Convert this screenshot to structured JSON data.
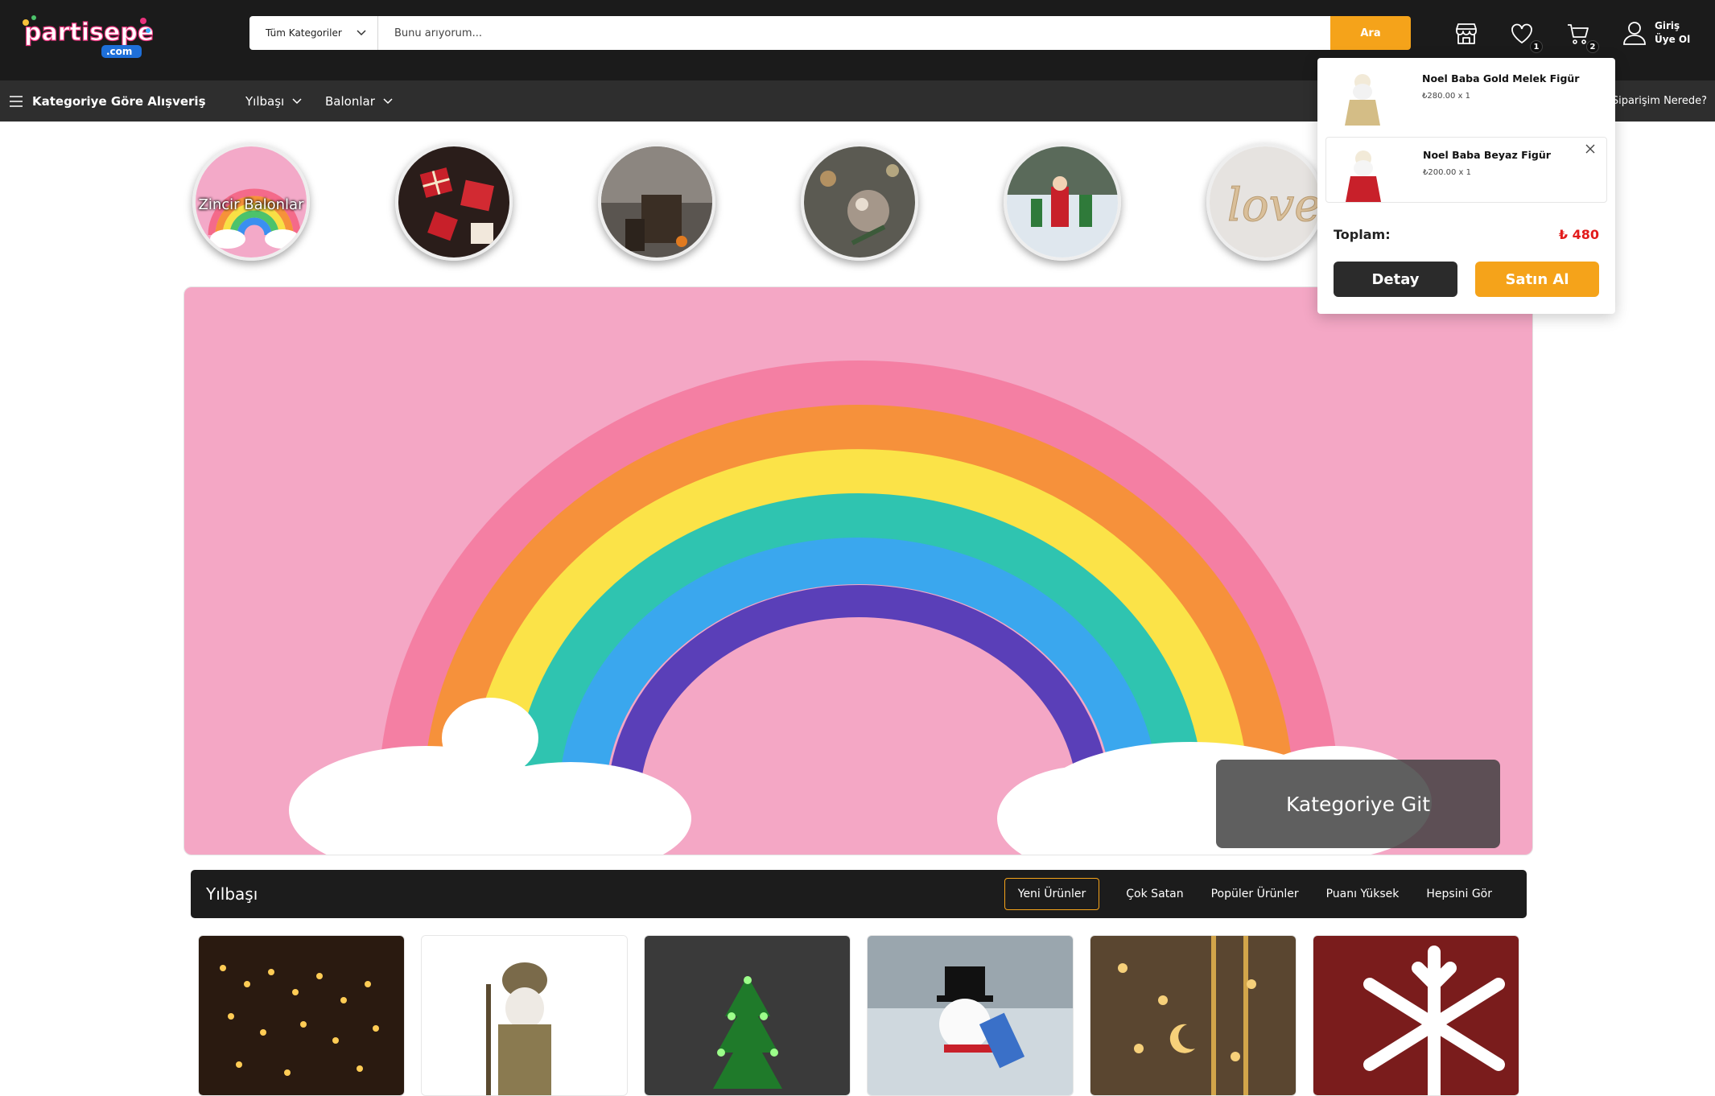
{
  "brand": {
    "name": "partisepeti",
    "domain": ".com",
    "colors": {
      "accent": "#f5a31a",
      "header_bg": "#1b1b1b",
      "nav_bg": "#2e2e2e",
      "price_red": "#e21b1b"
    }
  },
  "search": {
    "category_label": "Tüm Kategoriler",
    "placeholder": "Bunu arıyorum...",
    "button_label": "Ara"
  },
  "header_icons": {
    "store": "store-icon",
    "wishlist_count": "1",
    "cart_count": "2"
  },
  "account": {
    "line1": "Giriş",
    "line2": "Üye Ol"
  },
  "nav": {
    "shop_by_category": "Kategoriye Göre Alışveriş",
    "items": [
      {
        "label": "Yılbaşı"
      },
      {
        "label": "Balonlar"
      }
    ],
    "order_tracking": "Siparişim Nerede?"
  },
  "category_circles": [
    {
      "label": "Zincir Balonlar"
    }
  ],
  "banner": {
    "cta": "Kategoriye Git"
  },
  "section": {
    "title": "Yılbaşı",
    "tabs": [
      "Yeni Ürünler",
      "Çok Satan",
      "Popüler Ürünler",
      "Puanı Yüksek",
      "Hepsini Gör"
    ],
    "active_tab": "Yeni Ürünler"
  },
  "mini_cart": {
    "items": [
      {
        "name": "Noel Baba Gold Melek Figür",
        "price": "₺280.00 x 1"
      },
      {
        "name": "Noel Baba Beyaz Figür",
        "price": "₺200.00 x 1"
      }
    ],
    "total_label": "Toplam:",
    "total_value": "₺ 480",
    "detail_button": "Detay",
    "buy_button": "Satın Al"
  }
}
